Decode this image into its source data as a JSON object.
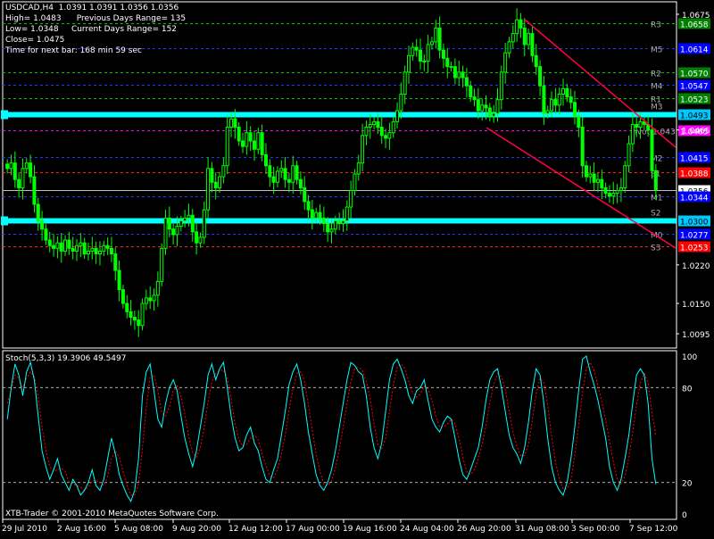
{
  "symbol_line": "USDCAD,H4  1.0391 1.0391 1.0356 1.0356",
  "info": {
    "high": "High= 1.0483",
    "prev_range": "Previous Days Range= 135",
    "low": "Low= 1.0348",
    "cur_range": "Current Days Range= 152",
    "close": "Close= 1.0475",
    "next_bar": "Time for next bar: 168 min 59 sec"
  },
  "indicator_label": "Stoch(5,3,3) 19.3906 49.5497",
  "copyright": "XTB-Trader © 2001-2010 MetaQuotes Software Corp.",
  "colors": {
    "candle": "#00ff00",
    "bid_line": "#c0c0c0",
    "pivot_blue": "#0000ff",
    "pivot_green": "#008000",
    "pivot_red": "#ff0000",
    "pivot_magenta": "#ff00ff",
    "cyan_level": "#00ffff",
    "trendline": "#ff0040",
    "stoch_main": "#00ffff",
    "stoch_signal": "#ff0000"
  },
  "price_axis": {
    "ticks": [
      "1.0675",
      "1.0635",
      "1.0595",
      "1.0555",
      "1.0515",
      "1.0475",
      "1.0435",
      "1.0395",
      "1.0355",
      "1.0315",
      "1.0275",
      "1.0235",
      "1.0195",
      "1.0155",
      "1.0115",
      "1.0075"
    ],
    "visible_ticks": [
      "1.0675",
      "1.0465",
      "1.0220",
      "1.0150",
      "1.0095"
    ]
  },
  "levels": [
    {
      "name": "R3",
      "value": 1.0658,
      "color": "green",
      "label": "1.0658"
    },
    {
      "name": "M5",
      "value": 1.0614,
      "color": "blue",
      "label": "1.0614"
    },
    {
      "name": "R2",
      "value": 1.057,
      "color": "green",
      "label": "1.0570"
    },
    {
      "name": "M4",
      "value": 1.0547,
      "color": "blue",
      "label": "1.0547"
    },
    {
      "name": "R1",
      "value": 1.0523,
      "color": "green",
      "label": "1.0523"
    },
    {
      "name": "M3",
      "value": 1.0493,
      "color": "cyan",
      "label": "1.0493"
    },
    {
      "name": "Pivot",
      "value": 1.0465,
      "color": "magenta",
      "label": "1.0465",
      "text": "Pivot 1.043"
    },
    {
      "name": "M2",
      "value": 1.0415,
      "color": "blue",
      "label": "1.0415"
    },
    {
      "name": "S1",
      "value": 1.0388,
      "color": "red",
      "label": "1.0388"
    },
    {
      "name": "bid",
      "value": 1.0356,
      "color": "white",
      "label": "1.0356"
    },
    {
      "name": "M1",
      "value": 1.0344,
      "color": "blue",
      "label": "1.0344"
    },
    {
      "name": "S2",
      "value": 1.03,
      "color": "cyan",
      "label": "1.0300"
    },
    {
      "name": "M0",
      "value": 1.0277,
      "color": "blue",
      "label": "1.0277"
    },
    {
      "name": "S3",
      "value": 1.0253,
      "color": "red",
      "label": "1.0253"
    }
  ],
  "stoch_axis": [
    "100",
    "80",
    "20",
    "0"
  ],
  "time_axis": [
    "29 Jul 2010",
    "2 Aug 16:00",
    "5 Aug 08:00",
    "9 Aug 20:00",
    "12 Aug 12:00",
    "17 Aug 00:00",
    "19 Aug 16:00",
    "24 Aug 04:00",
    "26 Aug 20:00",
    "31 Aug 08:00",
    "3 Sep 00:00",
    "7 Sep 12:00"
  ],
  "chart_data": {
    "type": "candlestick",
    "price_range": [
      1.0095,
      1.0675
    ],
    "closes": [
      1.0395,
      1.0405,
      1.0375,
      1.036,
      1.0395,
      1.0405,
      1.038,
      1.033,
      1.03,
      1.0285,
      1.0265,
      1.0255,
      1.025,
      1.026,
      1.0245,
      1.0265,
      1.025,
      1.0245,
      1.0255,
      1.026,
      1.024,
      1.0245,
      1.025,
      1.024,
      1.0245,
      1.0255,
      1.025,
      1.024,
      1.021,
      1.0175,
      1.015,
      1.0135,
      1.0125,
      1.012,
      1.011,
      1.015,
      1.016,
      1.0155,
      1.0165,
      1.019,
      1.025,
      1.0305,
      1.0285,
      1.0275,
      1.029,
      1.03,
      1.0305,
      1.031,
      1.028,
      1.026,
      1.027,
      1.032,
      1.0395,
      1.037,
      1.036,
      1.038,
      1.04,
      1.047,
      1.0485,
      1.047,
      1.0445,
      1.0435,
      1.046,
      1.0445,
      1.043,
      1.046,
      1.042,
      1.04,
      1.038,
      1.037,
      1.039,
      1.0395,
      1.0375,
      1.037,
      1.04,
      1.0375,
      1.036,
      1.0335,
      1.032,
      1.0305,
      1.0315,
      1.0305,
      1.0295,
      1.028,
      1.0285,
      1.03,
      1.0295,
      1.03,
      1.0325,
      1.0355,
      1.0385,
      1.0405,
      1.0455,
      1.047,
      1.0475,
      1.048,
      1.047,
      1.0455,
      1.045,
      1.046,
      1.048,
      1.05,
      1.053,
      1.057,
      1.06,
      1.0615,
      1.061,
      1.059,
      1.059,
      1.062,
      1.0625,
      1.065,
      1.061,
      1.0595,
      1.058,
      1.058,
      1.056,
      1.057,
      1.056,
      1.0545,
      1.0525,
      1.052,
      1.05,
      1.051,
      1.0505,
      1.049,
      1.0495,
      1.052,
      1.057,
      1.0605,
      1.0625,
      1.064,
      1.0665,
      1.065,
      1.062,
      1.064,
      1.06,
      1.058,
      1.0545,
      1.0495,
      1.05,
      1.052,
      1.051,
      1.053,
      1.054,
      1.0525,
      1.0515,
      1.049,
      1.047,
      1.04,
      1.038,
      1.0385,
      1.037,
      1.0375,
      1.036,
      1.035,
      1.0345,
      1.035,
      1.0355,
      1.036,
      1.04,
      1.044,
      1.0475,
      1.047,
      1.048,
      1.0475,
      1.0465,
      1.0391,
      1.0356
    ],
    "stoch_k": [
      60,
      80,
      95,
      88,
      75,
      90,
      96,
      85,
      62,
      40,
      30,
      22,
      28,
      35,
      25,
      20,
      15,
      22,
      18,
      12,
      15,
      20,
      28,
      18,
      15,
      22,
      35,
      48,
      38,
      25,
      18,
      12,
      8,
      15,
      35,
      75,
      90,
      95,
      78,
      60,
      55,
      70,
      80,
      85,
      78,
      62,
      48,
      38,
      30,
      40,
      55,
      70,
      88,
      95,
      85,
      92,
      96,
      80,
      62,
      48,
      40,
      42,
      50,
      55,
      45,
      40,
      30,
      22,
      20,
      28,
      35,
      50,
      65,
      82,
      90,
      95,
      85,
      70,
      52,
      38,
      25,
      18,
      15,
      20,
      28,
      40,
      55,
      70,
      85,
      96,
      94,
      90,
      88,
      75,
      55,
      42,
      35,
      45,
      65,
      85,
      95,
      98,
      92,
      85,
      75,
      70,
      78,
      80,
      85,
      72,
      60,
      55,
      52,
      58,
      62,
      60,
      48,
      35,
      25,
      22,
      28,
      35,
      42,
      55,
      72,
      85,
      90,
      92,
      80,
      65,
      50,
      42,
      38,
      32,
      42,
      58,
      78,
      92,
      88,
      70,
      48,
      30,
      20,
      15,
      12,
      20,
      35,
      55,
      78,
      98,
      100,
      90,
      82,
      72,
      60,
      48,
      30,
      20,
      15,
      22,
      35,
      50,
      70,
      88,
      92,
      88,
      70,
      35,
      19
    ],
    "stoch_d": [
      70,
      78,
      88,
      86,
      80,
      86,
      90,
      87,
      74,
      55,
      40,
      30,
      27,
      28,
      29,
      27,
      20,
      19,
      18,
      17,
      15,
      17,
      21,
      21,
      20,
      18,
      24,
      35,
      40,
      36,
      27,
      18,
      12,
      12,
      19,
      42,
      67,
      87,
      88,
      78,
      64,
      62,
      68,
      78,
      81,
      75,
      63,
      49,
      39,
      36,
      42,
      55,
      71,
      84,
      89,
      91,
      91,
      86,
      73,
      57,
      47,
      43,
      44,
      48,
      50,
      47,
      38,
      31,
      24,
      23,
      28,
      38,
      50,
      66,
      79,
      89,
      90,
      84,
      69,
      53,
      38,
      27,
      19,
      18,
      21,
      29,
      41,
      55,
      70,
      84,
      92,
      93,
      91,
      84,
      73,
      57,
      44,
      41,
      48,
      65,
      82,
      93,
      95,
      92,
      84,
      77,
      74,
      76,
      81,
      79,
      72,
      62,
      55,
      55,
      57,
      60,
      57,
      48,
      36,
      27,
      25,
      28,
      35,
      44,
      56,
      71,
      82,
      89,
      87,
      79,
      65,
      52,
      43,
      37,
      37,
      44,
      59,
      76,
      86,
      83,
      69,
      49,
      33,
      22,
      16,
      16,
      22,
      37,
      56,
      77,
      92,
      96,
      91,
      81,
      71,
      60,
      46,
      33,
      22,
      19,
      24,
      36,
      52,
      69,
      83,
      89,
      83,
      64,
      50
    ]
  }
}
